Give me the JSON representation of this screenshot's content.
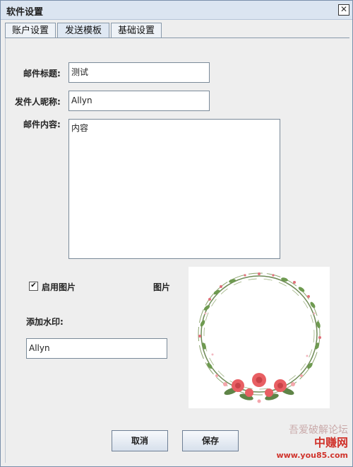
{
  "window": {
    "title": "软件设置"
  },
  "tabs": [
    {
      "label": "账户设置"
    },
    {
      "label": "发送模板"
    },
    {
      "label": "基础设置"
    }
  ],
  "form": {
    "subject_label": "邮件标题:",
    "subject_value": "测试",
    "sender_label": "发件人昵称:",
    "sender_value": "Allyn",
    "content_label": "邮件内容:",
    "content_value": "内容",
    "enable_image_label": "启用图片",
    "enable_image_checked": true,
    "image_label": "图片",
    "watermark_label": "添加水印:",
    "watermark_value": "Allyn"
  },
  "buttons": {
    "cancel": "取消",
    "save": "保存"
  },
  "site_watermark": {
    "line1": "吾爱破解论坛",
    "line2": "中赚网",
    "line3": "www.you85.com"
  }
}
